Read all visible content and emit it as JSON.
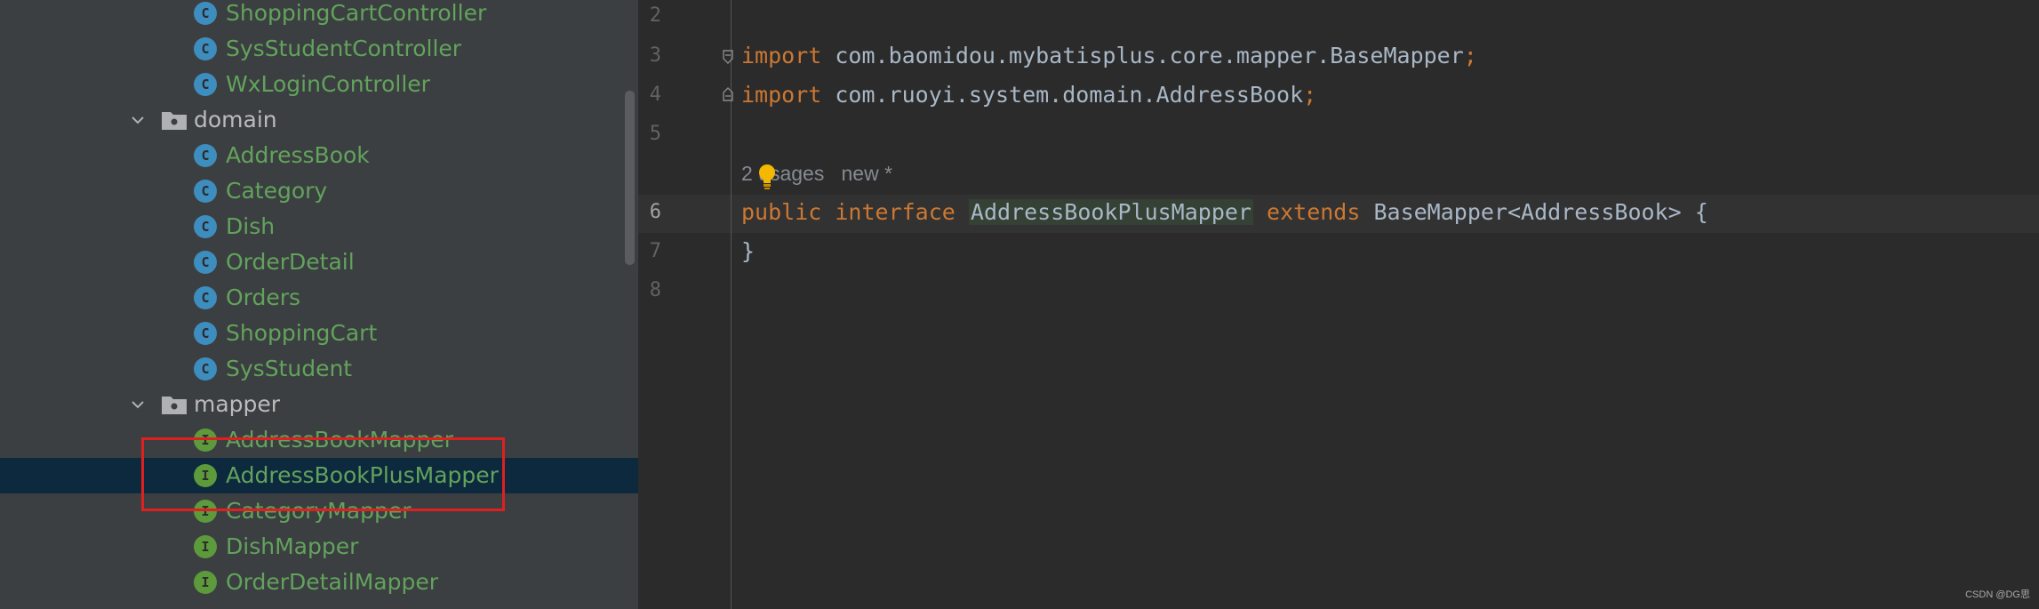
{
  "project_tree": {
    "items": [
      {
        "kind": "class",
        "badge": "C",
        "label": "ShoppingCartController"
      },
      {
        "kind": "class",
        "badge": "C",
        "label": "SysStudentController"
      },
      {
        "kind": "class",
        "badge": "C",
        "label": "WxLoginController"
      },
      {
        "kind": "folder",
        "label": "domain",
        "expanded": true
      },
      {
        "kind": "class",
        "badge": "C",
        "label": "AddressBook"
      },
      {
        "kind": "class",
        "badge": "C",
        "label": "Category"
      },
      {
        "kind": "class",
        "badge": "C",
        "label": "Dish"
      },
      {
        "kind": "class",
        "badge": "C",
        "label": "OrderDetail"
      },
      {
        "kind": "class",
        "badge": "C",
        "label": "Orders"
      },
      {
        "kind": "class",
        "badge": "C",
        "label": "ShoppingCart"
      },
      {
        "kind": "class",
        "badge": "C",
        "label": "SysStudent"
      },
      {
        "kind": "folder",
        "label": "mapper",
        "expanded": true
      },
      {
        "kind": "interface",
        "badge": "I",
        "label": "AddressBookMapper"
      },
      {
        "kind": "interface",
        "badge": "I",
        "label": "AddressBookPlusMapper",
        "selected": true
      },
      {
        "kind": "interface",
        "badge": "I",
        "label": "CategoryMapper"
      },
      {
        "kind": "interface",
        "badge": "I",
        "label": "DishMapper"
      },
      {
        "kind": "interface",
        "badge": "I",
        "label": "OrderDetailMapper"
      }
    ]
  },
  "editor": {
    "line_numbers": {
      "l2": "2",
      "l3": "3",
      "l4": "4",
      "l5": "5",
      "l6": "6",
      "l7": "7",
      "l8": "8"
    },
    "current_line": "6",
    "code": {
      "line3": {
        "keyword": "import",
        "path": " com.baomidou.mybatisplus.core.mapper.BaseMapper",
        "semicolon": ";"
      },
      "line4": {
        "keyword": "import",
        "path": " com.ruoyi.system.domain.AddressBook",
        "semicolon": ";"
      },
      "line6": {
        "kw_public": "public",
        "kw_interface": "interface",
        "type_name": "AddressBookPlusMapper",
        "kw_extends": "extends",
        "supertype": "BaseMapper<AddressBook> {"
      },
      "line7": {
        "text": "}"
      }
    },
    "inlay_hint": "2 usages   new *"
  },
  "colors": {
    "editor_bg": "#2b2b2b",
    "panel_bg": "#3c3f41",
    "keyword": "#cc7832",
    "identifier": "#a9b7c6",
    "tree_java_text": "#62a35c",
    "selection_bg": "#0d293e",
    "highlight_box": "#e02020"
  },
  "watermark": "CSDN @DG思"
}
